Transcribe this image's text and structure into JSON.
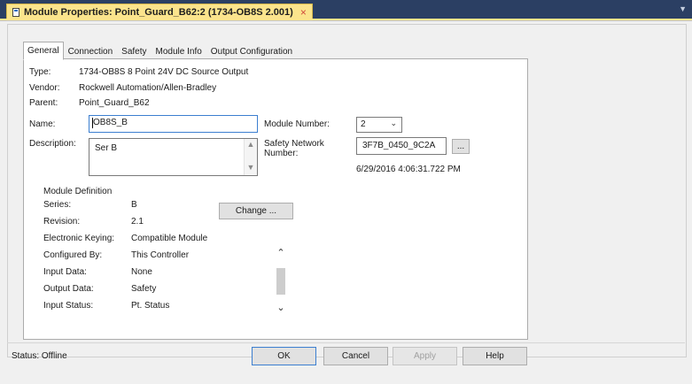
{
  "tab": {
    "title": "Module Properties: Point_Guard_B62:2 (1734-OB8S 2.001)",
    "close_glyph": "×",
    "overflow_glyph": "▼"
  },
  "prop_tabs": [
    {
      "label": "General",
      "active": true
    },
    {
      "label": "Connection",
      "active": false
    },
    {
      "label": "Safety",
      "active": false
    },
    {
      "label": "Module Info",
      "active": false
    },
    {
      "label": "Output Configuration",
      "active": false
    }
  ],
  "general": {
    "type_label": "Type:",
    "type_value": "1734-OB8S 8 Point 24V DC Source Output",
    "vendor_label": "Vendor:",
    "vendor_value": "Rockwell Automation/Allen-Bradley",
    "parent_label": "Parent:",
    "parent_value": "Point_Guard_B62",
    "name_label": "Name:",
    "name_value": "OB8S_B",
    "description_label": "Description:",
    "description_value": "Ser B",
    "module_number_label": "Module Number:",
    "module_number_value": "2",
    "safety_network_label_1": "Safety Network",
    "safety_network_label_2": "Number:",
    "safety_network_value": "3F7B_0450_9C2A",
    "safety_network_button": "...",
    "safety_network_timestamp": "6/29/2016 4:06:31.722 PM"
  },
  "module_definition": {
    "heading": "Module Definition",
    "series_label": "Series:",
    "series_value": "B",
    "revision_label": "Revision:",
    "revision_value": "2.1",
    "keying_label": "Electronic Keying:",
    "keying_value": "Compatible Module",
    "configured_label": "Configured By:",
    "configured_value": "This Controller",
    "input_data_label": "Input Data:",
    "input_data_value": "None",
    "output_data_label": "Output Data:",
    "output_data_value": "Safety",
    "input_status_label": "Input Status:",
    "input_status_value": "Pt. Status",
    "change_button": "Change ...",
    "scroll_up_glyph": "⌃",
    "scroll_down_glyph": "⌄"
  },
  "footer": {
    "status": "Status:  Offline",
    "ok": "OK",
    "cancel": "Cancel",
    "apply": "Apply",
    "help": "Help"
  },
  "colors": {
    "tab_active": "#fbe48c",
    "tab_strip": "#2b3f63",
    "focus_border": "#3c7fd0"
  }
}
